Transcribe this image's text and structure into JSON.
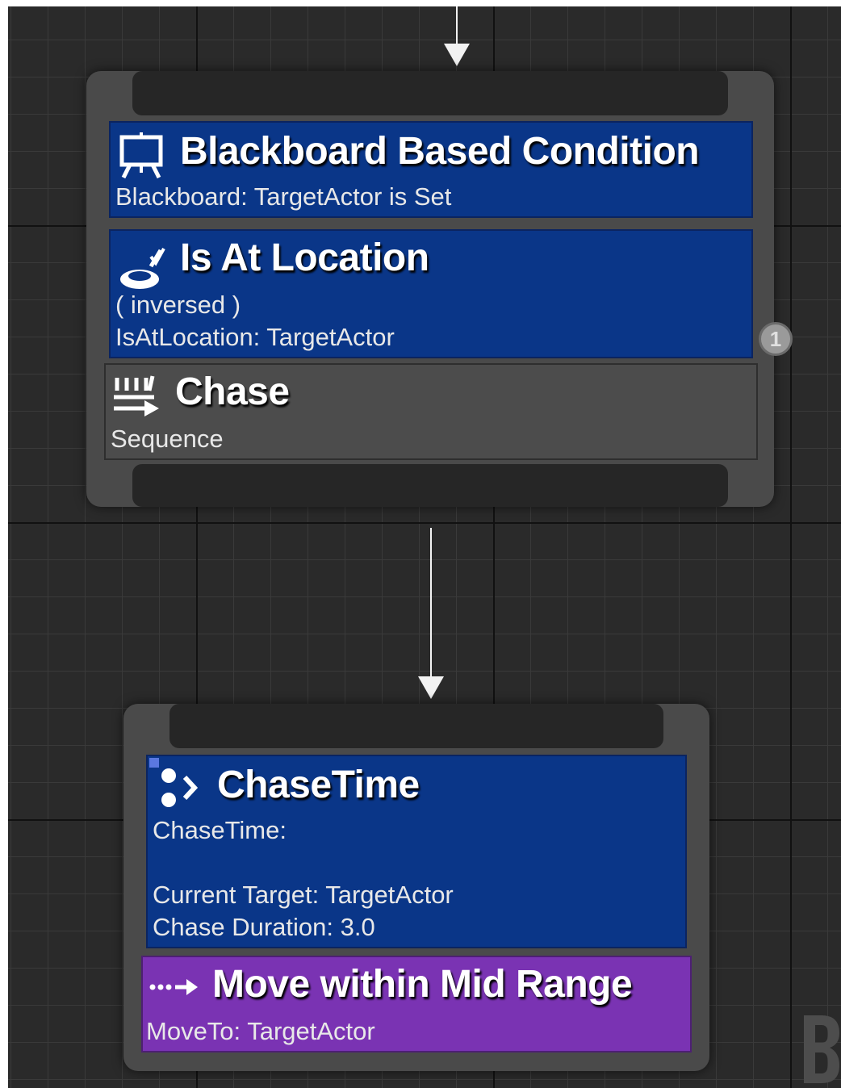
{
  "node1": {
    "decorator_1": {
      "icon": "blackboard-icon",
      "title": "Blackboard Based Condition",
      "subtitle": "Blackboard: TargetActor is Set"
    },
    "decorator_2": {
      "icon": "location-icon",
      "title": "Is At Location",
      "line1": "( inversed )",
      "line2": "IsAtLocation: TargetActor",
      "badge": "1"
    },
    "composite": {
      "icon": "sequence-icon",
      "title": "Chase",
      "subtitle": "Sequence"
    }
  },
  "node2": {
    "service": {
      "icon": "service-icon",
      "title": "ChaseTime",
      "line1": "ChaseTime:",
      "line2": "Current Target: TargetActor",
      "line3": "Chase Duration: 3.0"
    },
    "task": {
      "icon": "moveto-icon",
      "title": "Move within Mid Range",
      "subtitle": "MoveTo: TargetActor"
    }
  },
  "colors": {
    "graph_bg": "#2a2a2a",
    "decorator_blue": "#0a3688",
    "composite_gray": "#4c4c4c",
    "task_purple": "#7a33b3"
  }
}
